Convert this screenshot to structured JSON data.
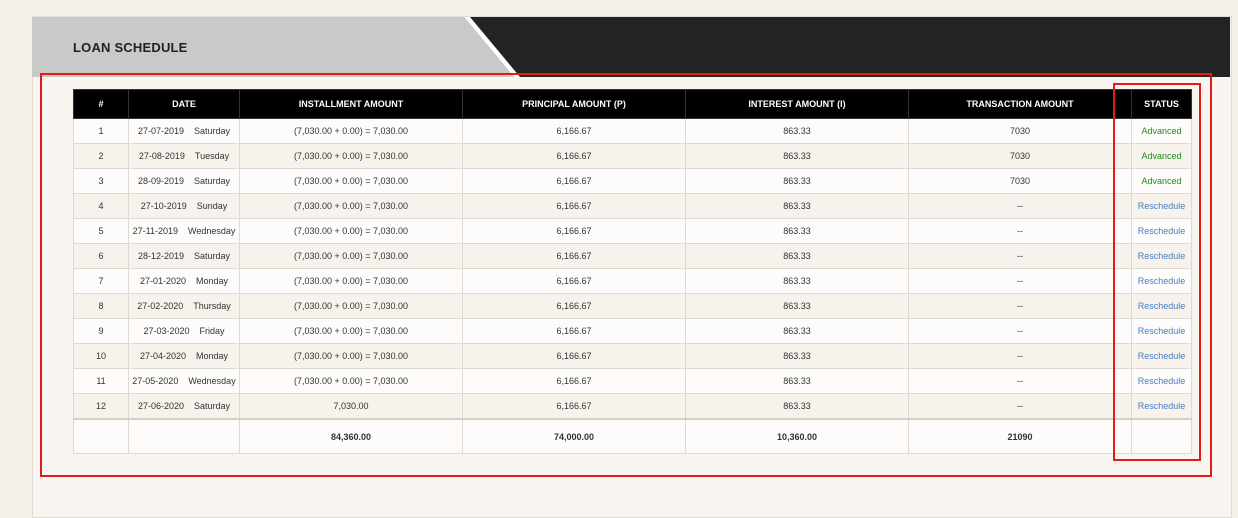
{
  "header": {
    "title": "LOAN SCHEDULE"
  },
  "colors": {
    "advanced": "#1e8e1e",
    "reschedule": "#4a7ec2",
    "header_dark": "#222222",
    "header_light": "#c8c8c8",
    "highlight": "#e21b1b"
  },
  "table": {
    "columns": [
      "#",
      "DATE",
      "INSTALLMENT AMOUNT",
      "PRINCIPAL AMOUNT (P)",
      "INTEREST AMOUNT (I)",
      "TRANSACTION AMOUNT",
      "STATUS"
    ],
    "rows": [
      {
        "num": "1",
        "date": "27-07-2019",
        "day": "Saturday",
        "installment": "(7,030.00 + 0.00) = 7,030.00",
        "principal": "6,166.67",
        "interest": "863.33",
        "transaction": "7030",
        "status": "Advanced",
        "status_type": "advanced"
      },
      {
        "num": "2",
        "date": "27-08-2019",
        "day": "Tuesday",
        "installment": "(7,030.00 + 0.00) = 7,030.00",
        "principal": "6,166.67",
        "interest": "863.33",
        "transaction": "7030",
        "status": "Advanced",
        "status_type": "advanced"
      },
      {
        "num": "3",
        "date": "28-09-2019",
        "day": "Saturday",
        "installment": "(7,030.00 + 0.00) = 7,030.00",
        "principal": "6,166.67",
        "interest": "863.33",
        "transaction": "7030",
        "status": "Advanced",
        "status_type": "advanced"
      },
      {
        "num": "4",
        "date": "27-10-2019",
        "day": "Sunday",
        "installment": "(7,030.00 + 0.00) = 7,030.00",
        "principal": "6,166.67",
        "interest": "863.33",
        "transaction": "--",
        "status": "Reschedule",
        "status_type": "reschedule"
      },
      {
        "num": "5",
        "date": "27-11-2019",
        "day": "Wednesday",
        "installment": "(7,030.00 + 0.00) = 7,030.00",
        "principal": "6,166.67",
        "interest": "863.33",
        "transaction": "--",
        "status": "Reschedule",
        "status_type": "reschedule"
      },
      {
        "num": "6",
        "date": "28-12-2019",
        "day": "Saturday",
        "installment": "(7,030.00 + 0.00) = 7,030.00",
        "principal": "6,166.67",
        "interest": "863.33",
        "transaction": "--",
        "status": "Reschedule",
        "status_type": "reschedule"
      },
      {
        "num": "7",
        "date": "27-01-2020",
        "day": "Monday",
        "installment": "(7,030.00 + 0.00) = 7,030.00",
        "principal": "6,166.67",
        "interest": "863.33",
        "transaction": "--",
        "status": "Reschedule",
        "status_type": "reschedule"
      },
      {
        "num": "8",
        "date": "27-02-2020",
        "day": "Thursday",
        "installment": "(7,030.00 + 0.00) = 7,030.00",
        "principal": "6,166.67",
        "interest": "863.33",
        "transaction": "--",
        "status": "Reschedule",
        "status_type": "reschedule"
      },
      {
        "num": "9",
        "date": "27-03-2020",
        "day": "Friday",
        "installment": "(7,030.00 + 0.00) = 7,030.00",
        "principal": "6,166.67",
        "interest": "863.33",
        "transaction": "--",
        "status": "Reschedule",
        "status_type": "reschedule"
      },
      {
        "num": "10",
        "date": "27-04-2020",
        "day": "Monday",
        "installment": "(7,030.00 + 0.00) = 7,030.00",
        "principal": "6,166.67",
        "interest": "863.33",
        "transaction": "--",
        "status": "Reschedule",
        "status_type": "reschedule"
      },
      {
        "num": "11",
        "date": "27-05-2020",
        "day": "Wednesday",
        "installment": "(7,030.00 + 0.00) = 7,030.00",
        "principal": "6,166.67",
        "interest": "863.33",
        "transaction": "--",
        "status": "Reschedule",
        "status_type": "reschedule"
      },
      {
        "num": "12",
        "date": "27-06-2020",
        "day": "Saturday",
        "installment": "7,030.00",
        "principal": "6,166.67",
        "interest": "863.33",
        "transaction": "--",
        "status": "Reschedule",
        "status_type": "reschedule"
      }
    ],
    "totals": {
      "num": "",
      "date": "",
      "installment": "84,360.00",
      "principal": "74,000.00",
      "interest": "10,360.00",
      "transaction": "21090",
      "status": ""
    }
  }
}
